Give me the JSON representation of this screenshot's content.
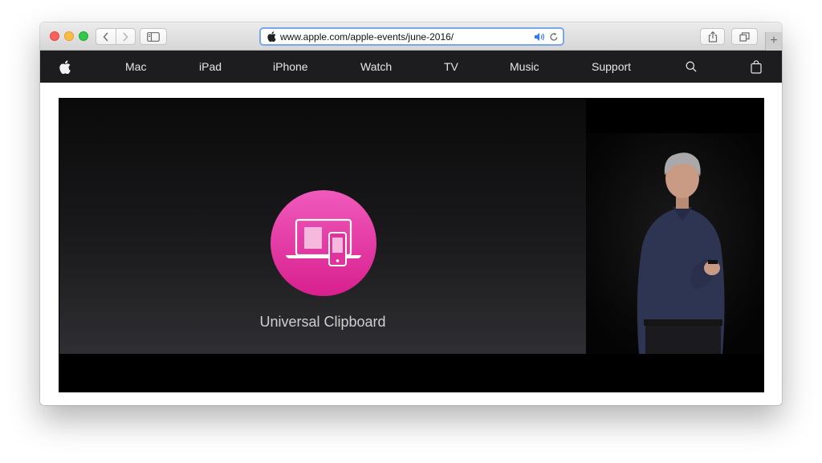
{
  "browser": {
    "url": "www.apple.com/apple-events/june-2016/",
    "new_tab": "+"
  },
  "global_nav": {
    "items": [
      {
        "label": "Mac"
      },
      {
        "label": "iPad"
      },
      {
        "label": "iPhone"
      },
      {
        "label": "Watch"
      },
      {
        "label": "TV"
      },
      {
        "label": "Music"
      },
      {
        "label": "Support"
      }
    ],
    "icons": [
      "apple-logo",
      "search-icon",
      "bag-icon"
    ]
  },
  "video": {
    "slide_title": "Universal Clipboard",
    "accent_color": "#e33aa6"
  }
}
